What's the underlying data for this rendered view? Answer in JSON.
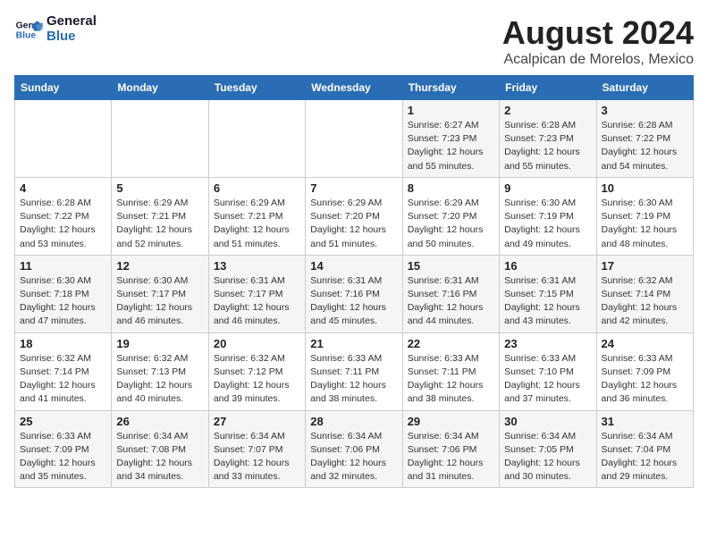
{
  "logo": {
    "line1": "General",
    "line2": "Blue"
  },
  "title": "August 2024",
  "subtitle": "Acalpican de Morelos, Mexico",
  "weekdays": [
    "Sunday",
    "Monday",
    "Tuesday",
    "Wednesday",
    "Thursday",
    "Friday",
    "Saturday"
  ],
  "weeks": [
    [
      {
        "day": "",
        "info": ""
      },
      {
        "day": "",
        "info": ""
      },
      {
        "day": "",
        "info": ""
      },
      {
        "day": "",
        "info": ""
      },
      {
        "day": "1",
        "info": "Sunrise: 6:27 AM\nSunset: 7:23 PM\nDaylight: 12 hours\nand 55 minutes."
      },
      {
        "day": "2",
        "info": "Sunrise: 6:28 AM\nSunset: 7:23 PM\nDaylight: 12 hours\nand 55 minutes."
      },
      {
        "day": "3",
        "info": "Sunrise: 6:28 AM\nSunset: 7:22 PM\nDaylight: 12 hours\nand 54 minutes."
      }
    ],
    [
      {
        "day": "4",
        "info": "Sunrise: 6:28 AM\nSunset: 7:22 PM\nDaylight: 12 hours\nand 53 minutes."
      },
      {
        "day": "5",
        "info": "Sunrise: 6:29 AM\nSunset: 7:21 PM\nDaylight: 12 hours\nand 52 minutes."
      },
      {
        "day": "6",
        "info": "Sunrise: 6:29 AM\nSunset: 7:21 PM\nDaylight: 12 hours\nand 51 minutes."
      },
      {
        "day": "7",
        "info": "Sunrise: 6:29 AM\nSunset: 7:20 PM\nDaylight: 12 hours\nand 51 minutes."
      },
      {
        "day": "8",
        "info": "Sunrise: 6:29 AM\nSunset: 7:20 PM\nDaylight: 12 hours\nand 50 minutes."
      },
      {
        "day": "9",
        "info": "Sunrise: 6:30 AM\nSunset: 7:19 PM\nDaylight: 12 hours\nand 49 minutes."
      },
      {
        "day": "10",
        "info": "Sunrise: 6:30 AM\nSunset: 7:19 PM\nDaylight: 12 hours\nand 48 minutes."
      }
    ],
    [
      {
        "day": "11",
        "info": "Sunrise: 6:30 AM\nSunset: 7:18 PM\nDaylight: 12 hours\nand 47 minutes."
      },
      {
        "day": "12",
        "info": "Sunrise: 6:30 AM\nSunset: 7:17 PM\nDaylight: 12 hours\nand 46 minutes."
      },
      {
        "day": "13",
        "info": "Sunrise: 6:31 AM\nSunset: 7:17 PM\nDaylight: 12 hours\nand 46 minutes."
      },
      {
        "day": "14",
        "info": "Sunrise: 6:31 AM\nSunset: 7:16 PM\nDaylight: 12 hours\nand 45 minutes."
      },
      {
        "day": "15",
        "info": "Sunrise: 6:31 AM\nSunset: 7:16 PM\nDaylight: 12 hours\nand 44 minutes."
      },
      {
        "day": "16",
        "info": "Sunrise: 6:31 AM\nSunset: 7:15 PM\nDaylight: 12 hours\nand 43 minutes."
      },
      {
        "day": "17",
        "info": "Sunrise: 6:32 AM\nSunset: 7:14 PM\nDaylight: 12 hours\nand 42 minutes."
      }
    ],
    [
      {
        "day": "18",
        "info": "Sunrise: 6:32 AM\nSunset: 7:14 PM\nDaylight: 12 hours\nand 41 minutes."
      },
      {
        "day": "19",
        "info": "Sunrise: 6:32 AM\nSunset: 7:13 PM\nDaylight: 12 hours\nand 40 minutes."
      },
      {
        "day": "20",
        "info": "Sunrise: 6:32 AM\nSunset: 7:12 PM\nDaylight: 12 hours\nand 39 minutes."
      },
      {
        "day": "21",
        "info": "Sunrise: 6:33 AM\nSunset: 7:11 PM\nDaylight: 12 hours\nand 38 minutes."
      },
      {
        "day": "22",
        "info": "Sunrise: 6:33 AM\nSunset: 7:11 PM\nDaylight: 12 hours\nand 38 minutes."
      },
      {
        "day": "23",
        "info": "Sunrise: 6:33 AM\nSunset: 7:10 PM\nDaylight: 12 hours\nand 37 minutes."
      },
      {
        "day": "24",
        "info": "Sunrise: 6:33 AM\nSunset: 7:09 PM\nDaylight: 12 hours\nand 36 minutes."
      }
    ],
    [
      {
        "day": "25",
        "info": "Sunrise: 6:33 AM\nSunset: 7:09 PM\nDaylight: 12 hours\nand 35 minutes."
      },
      {
        "day": "26",
        "info": "Sunrise: 6:34 AM\nSunset: 7:08 PM\nDaylight: 12 hours\nand 34 minutes."
      },
      {
        "day": "27",
        "info": "Sunrise: 6:34 AM\nSunset: 7:07 PM\nDaylight: 12 hours\nand 33 minutes."
      },
      {
        "day": "28",
        "info": "Sunrise: 6:34 AM\nSunset: 7:06 PM\nDaylight: 12 hours\nand 32 minutes."
      },
      {
        "day": "29",
        "info": "Sunrise: 6:34 AM\nSunset: 7:06 PM\nDaylight: 12 hours\nand 31 minutes."
      },
      {
        "day": "30",
        "info": "Sunrise: 6:34 AM\nSunset: 7:05 PM\nDaylight: 12 hours\nand 30 minutes."
      },
      {
        "day": "31",
        "info": "Sunrise: 6:34 AM\nSunset: 7:04 PM\nDaylight: 12 hours\nand 29 minutes."
      }
    ]
  ]
}
